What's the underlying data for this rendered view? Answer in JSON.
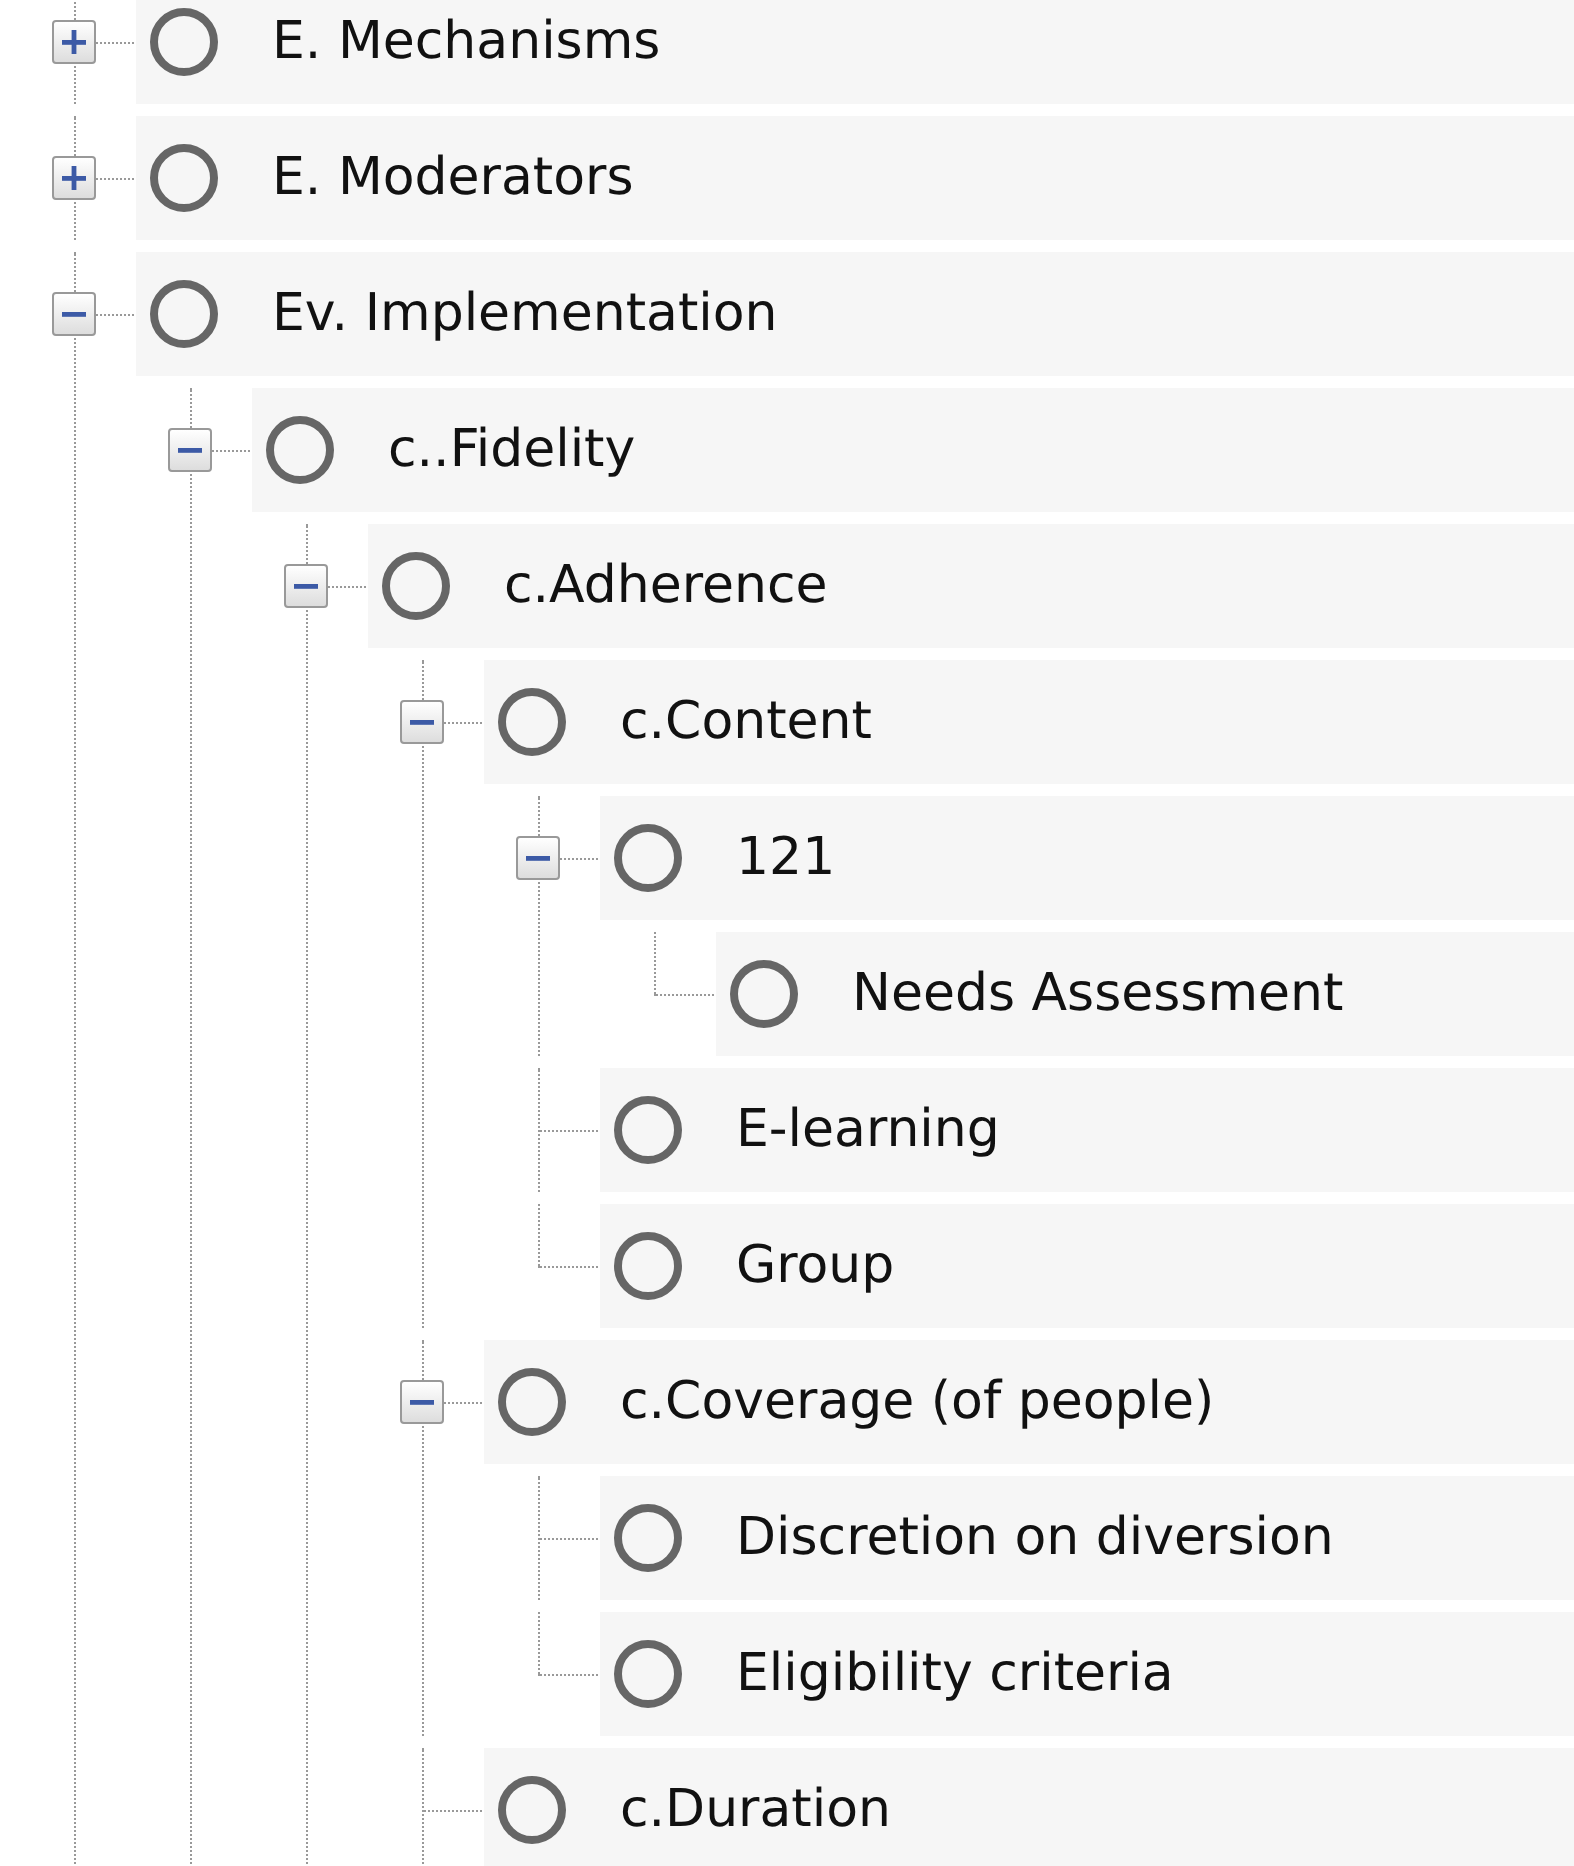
{
  "tree": {
    "items": [
      {
        "label": "E. Mechanisms",
        "expanded": false
      },
      {
        "label": "E. Moderators",
        "expanded": false
      },
      {
        "label": "Ev. Implementation",
        "expanded": true,
        "continues": true,
        "children": [
          {
            "label": "c..Fidelity",
            "expanded": true,
            "continues": true,
            "children": [
              {
                "label": "c.Adherence",
                "expanded": true,
                "continues": true,
                "children": [
                  {
                    "label": "c.Content",
                    "expanded": true,
                    "children": [
                      {
                        "label": "121",
                        "expanded": true,
                        "children": [
                          {
                            "label": "Needs Assessment"
                          }
                        ]
                      },
                      {
                        "label": "E-learning"
                      },
                      {
                        "label": "Group"
                      }
                    ]
                  },
                  {
                    "label": "c.Coverage (of people)",
                    "expanded": true,
                    "children": [
                      {
                        "label": "Discretion on diversion"
                      },
                      {
                        "label": "Eligibility criteria"
                      }
                    ]
                  },
                  {
                    "label": "c.Duration",
                    "continues": true
                  }
                ]
              }
            ]
          }
        ]
      }
    ]
  }
}
